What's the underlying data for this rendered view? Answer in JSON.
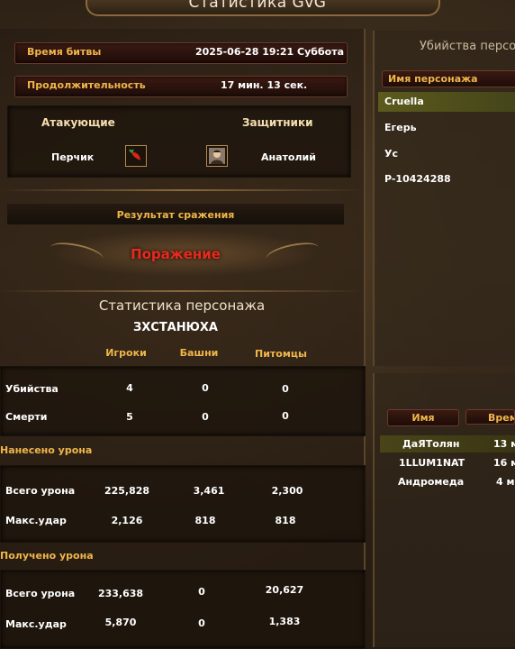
{
  "window_title": "Статистика GvG",
  "battle_info": {
    "time_label": "Время битвы",
    "time_value": "2025-06-28 19:21 Суббота",
    "duration_label": "Продолжительность",
    "duration_value": "17 мин. 13 сек."
  },
  "sides": {
    "attackers_label": "Атакующие",
    "defenders_label": "Защитники",
    "attacker_name": "Перчик",
    "defender_name": "Анатолий",
    "attacker_icon": "chili-pepper-icon",
    "defender_icon": "portrait-icon"
  },
  "result": {
    "label": "Результат сражения",
    "value": "Поражение",
    "color": "#e8291d"
  },
  "character_stats": {
    "title": "Статистика персонажа",
    "name": "ЗХСТАНЮХА",
    "columns": [
      "Игроки",
      "Башни",
      "Питомцы"
    ],
    "kills_deaths": [
      {
        "label": "Убийства",
        "values": [
          "4",
          "0",
          "0"
        ]
      },
      {
        "label": "Смерти",
        "values": [
          "5",
          "0",
          "0"
        ]
      }
    ],
    "damage_dealt_title": "Нанесено урона",
    "damage_dealt": [
      {
        "label": "Всего урона",
        "values": [
          "225,828",
          "3,461",
          "2,300"
        ]
      },
      {
        "label": "Макс.удар",
        "values": [
          "2,126",
          "818",
          "818"
        ]
      }
    ],
    "damage_taken_title": "Получено урона",
    "damage_taken": [
      {
        "label": "Всего урона",
        "values": [
          "233,638",
          "0",
          "20,627"
        ]
      },
      {
        "label": "Макс.удар",
        "values": [
          "5,870",
          "0",
          "1,383"
        ]
      }
    ]
  },
  "kills_panel": {
    "title": "Убийства персо",
    "header": "Имя персонажа",
    "rows": [
      "Cruella",
      "Егерь",
      "Ус",
      "P-10424288"
    ]
  },
  "time_panel": {
    "header_name": "Имя",
    "header_time": "Врем",
    "rows": [
      {
        "name": "ДаЯТолян",
        "time": "13 м"
      },
      {
        "name": "1LLUM1NAT",
        "time": "16 м"
      },
      {
        "name": "Андромеда",
        "time": "4 м"
      }
    ]
  }
}
